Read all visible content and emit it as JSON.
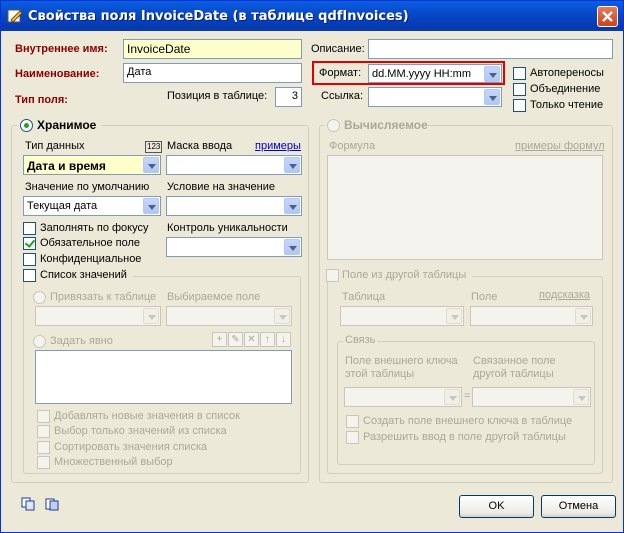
{
  "window": {
    "title": "Свойства поля InvoiceDate (в таблице qdfInvoices)"
  },
  "top": {
    "internal_name_label": "Внутреннее имя:",
    "internal_name_value": "InvoiceDate",
    "name_label": "Наименование:",
    "name_value": "Дата",
    "field_type_label": "Тип поля:",
    "position_label": "Позиция в таблице:",
    "position_value": "3",
    "description_label": "Описание:",
    "description_value": "",
    "format_label": "Формат:",
    "format_value": "dd.MM.yyyy HH:mm",
    "link_label": "Ссылка:",
    "link_value": "",
    "wrap_label": "Автопереносы",
    "merge_label": "Объединение",
    "readonly_label": "Только чтение"
  },
  "stored": {
    "title": "Хранимое",
    "data_type_label": "Тип данных",
    "data_type_badge": "123",
    "data_type_value": "Дата и время",
    "input_mask_label": "Маска ввода",
    "examples_link": "примеры",
    "default_label": "Значение по умолчанию",
    "default_value": "Текущая дата",
    "condition_label": "Условие на значение",
    "fill_focus_label": "Заполнять по фокусу",
    "required_label": "Обязательное поле",
    "confidential_label": "Конфиденциальное",
    "uniqueness_label": "Контроль уникальности",
    "value_list_label": "Список значений",
    "bind_table_label": "Привязать к таблице",
    "selected_field_label": "Выбираемое поле",
    "explicit_label": "Задать явно",
    "add_new_label": "Добавлять новые значения в список",
    "choose_only_label": "Выбор только значений из списка",
    "sort_label": "Сортировать значения списка",
    "multi_label": "Множественный выбор"
  },
  "calculated": {
    "title": "Вычисляемое",
    "formula_label": "Формула",
    "formula_examples_link": "примеры формул",
    "other_table_label": "Поле из другой таблицы",
    "table_label": "Таблица",
    "field_label": "Поле",
    "hint_link": "подсказка",
    "link_group_label": "Связь",
    "fk_this_label_1": "Поле внешнего ключа",
    "fk_this_label_2": "этой таблицы",
    "linked_other_label_1": "Связанное поле",
    "linked_other_label_2": "другой таблицы",
    "equals": "=",
    "create_fk_label": "Создать поле внешнего ключа в таблице",
    "allow_input_label": "Разрешить ввод в поле другой таблицы"
  },
  "footer": {
    "ok_label": "OK",
    "cancel_label": "Отмена"
  }
}
